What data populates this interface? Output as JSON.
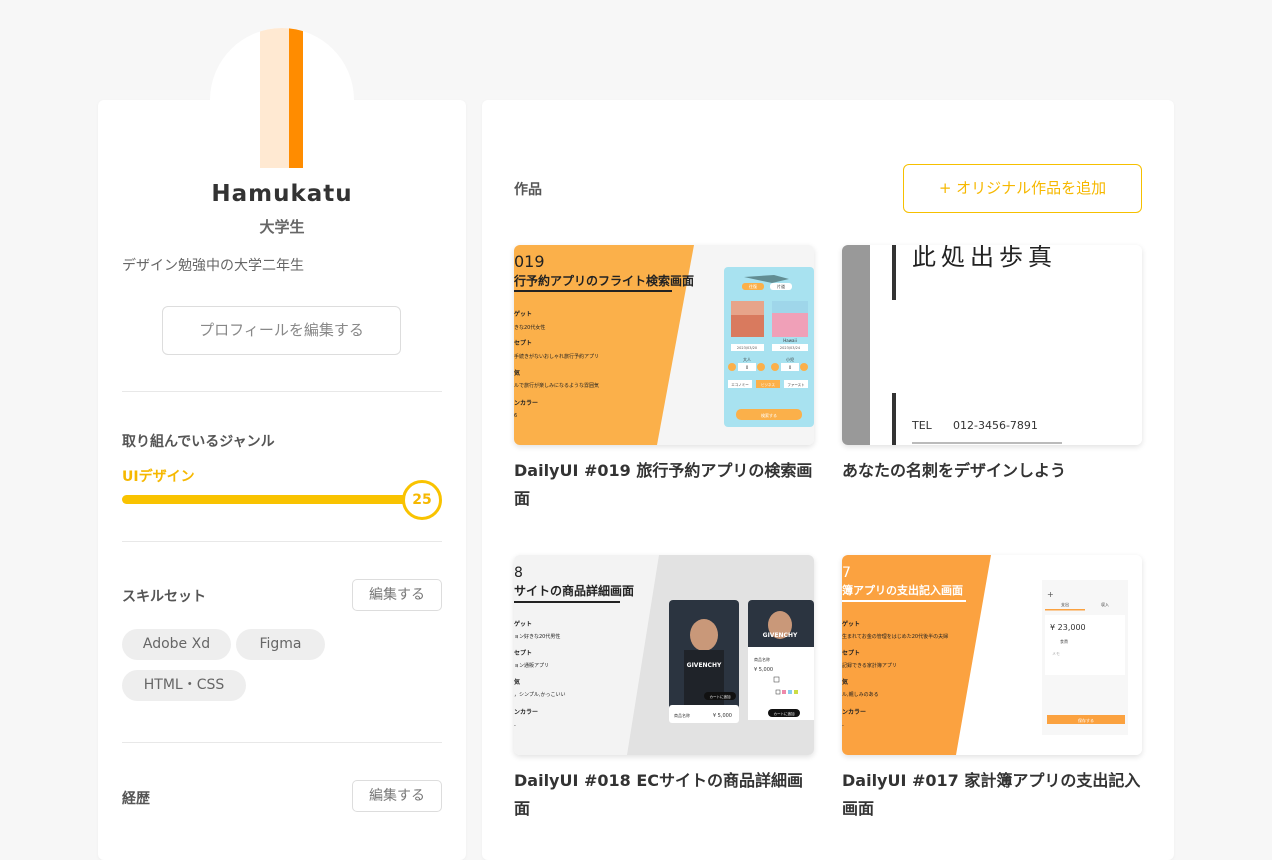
{
  "profile": {
    "name": "Hamukatu",
    "role": "大学生",
    "bio": "デザイン勉強中の大学二年生",
    "edit_button": "プロフィールを編集する"
  },
  "genre": {
    "heading": "取り組んでいるジャンル",
    "name": "UIデザイン",
    "level": "25"
  },
  "skills": {
    "heading": "スキルセット",
    "edit_button": "編集する",
    "items": [
      "Adobe Xd",
      "Figma",
      "HTML・CSS"
    ]
  },
  "career": {
    "heading": "経歴",
    "edit_button": "編集する"
  },
  "works": {
    "heading": "作品",
    "add_button": "+ オリジナル作品を追加",
    "items": [
      {
        "title": "DailyUI #019 旅行予約アプリの検索画面",
        "thumb": {
          "number": "019",
          "headline": "行予約アプリのフライト検索画面",
          "lines": [
            "ゲット",
            "きな20代女性",
            "セプト",
            "手続きがないおしゃれ旅行予約アプリ",
            "気",
            "ルで旅行が楽しみになるような雰囲気",
            "ンカラー",
            "6"
          ],
          "phone_labels": [
            "往復",
            "片道",
            "Hawaii",
            "2023/03/20",
            "2023/03/24",
            "大人",
            "小児",
            "0",
            "0",
            "エコノミー",
            "ビジネス",
            "ファースト",
            "検索する"
          ]
        }
      },
      {
        "title": "あなたの名刺をデザインしよう",
        "thumb": {
          "name_text": "此処出歩真",
          "tel_label": "TEL",
          "tel_value": "012-3456-7891"
        }
      },
      {
        "title": "DailyUI #018 ECサイトの商品詳細画面",
        "thumb": {
          "number": "8",
          "headline": "サイトの商品詳細画面",
          "lines": [
            "ゲット",
            "ョン好きな20代男性",
            "セプト",
            "ョン通販アプリ",
            "気",
            "，シンプル,かっこいい",
            "ンカラー",
            "-"
          ],
          "phone_labels": [
            "GIVENCHY",
            "GIVENCHY",
            "¥ 5,000",
            "¥ 5,000",
            "カートに追加",
            "カートに追加",
            "商品名称",
            "商品名称"
          ]
        }
      },
      {
        "title": "DailyUI #017 家計簿アプリの支出記入画面",
        "thumb": {
          "number": "7",
          "headline": "簿アプリの支出記入画面",
          "lines": [
            "ゲット",
            "生まれてお金の管理をはじめた20代後半の夫婦",
            "セプト",
            "記録できる家計簿アプリ",
            "気",
            "ル,親しみのある",
            "ンカラー",
            "-"
          ],
          "phone_labels": [
            "支出",
            "収入",
            "¥ 23,000",
            "食費",
            "メモ",
            "保存する"
          ]
        }
      }
    ]
  },
  "colors": {
    "accent": "#f6b800",
    "orange": "#ff8c00",
    "thumb_orange": "#fbb04a"
  }
}
